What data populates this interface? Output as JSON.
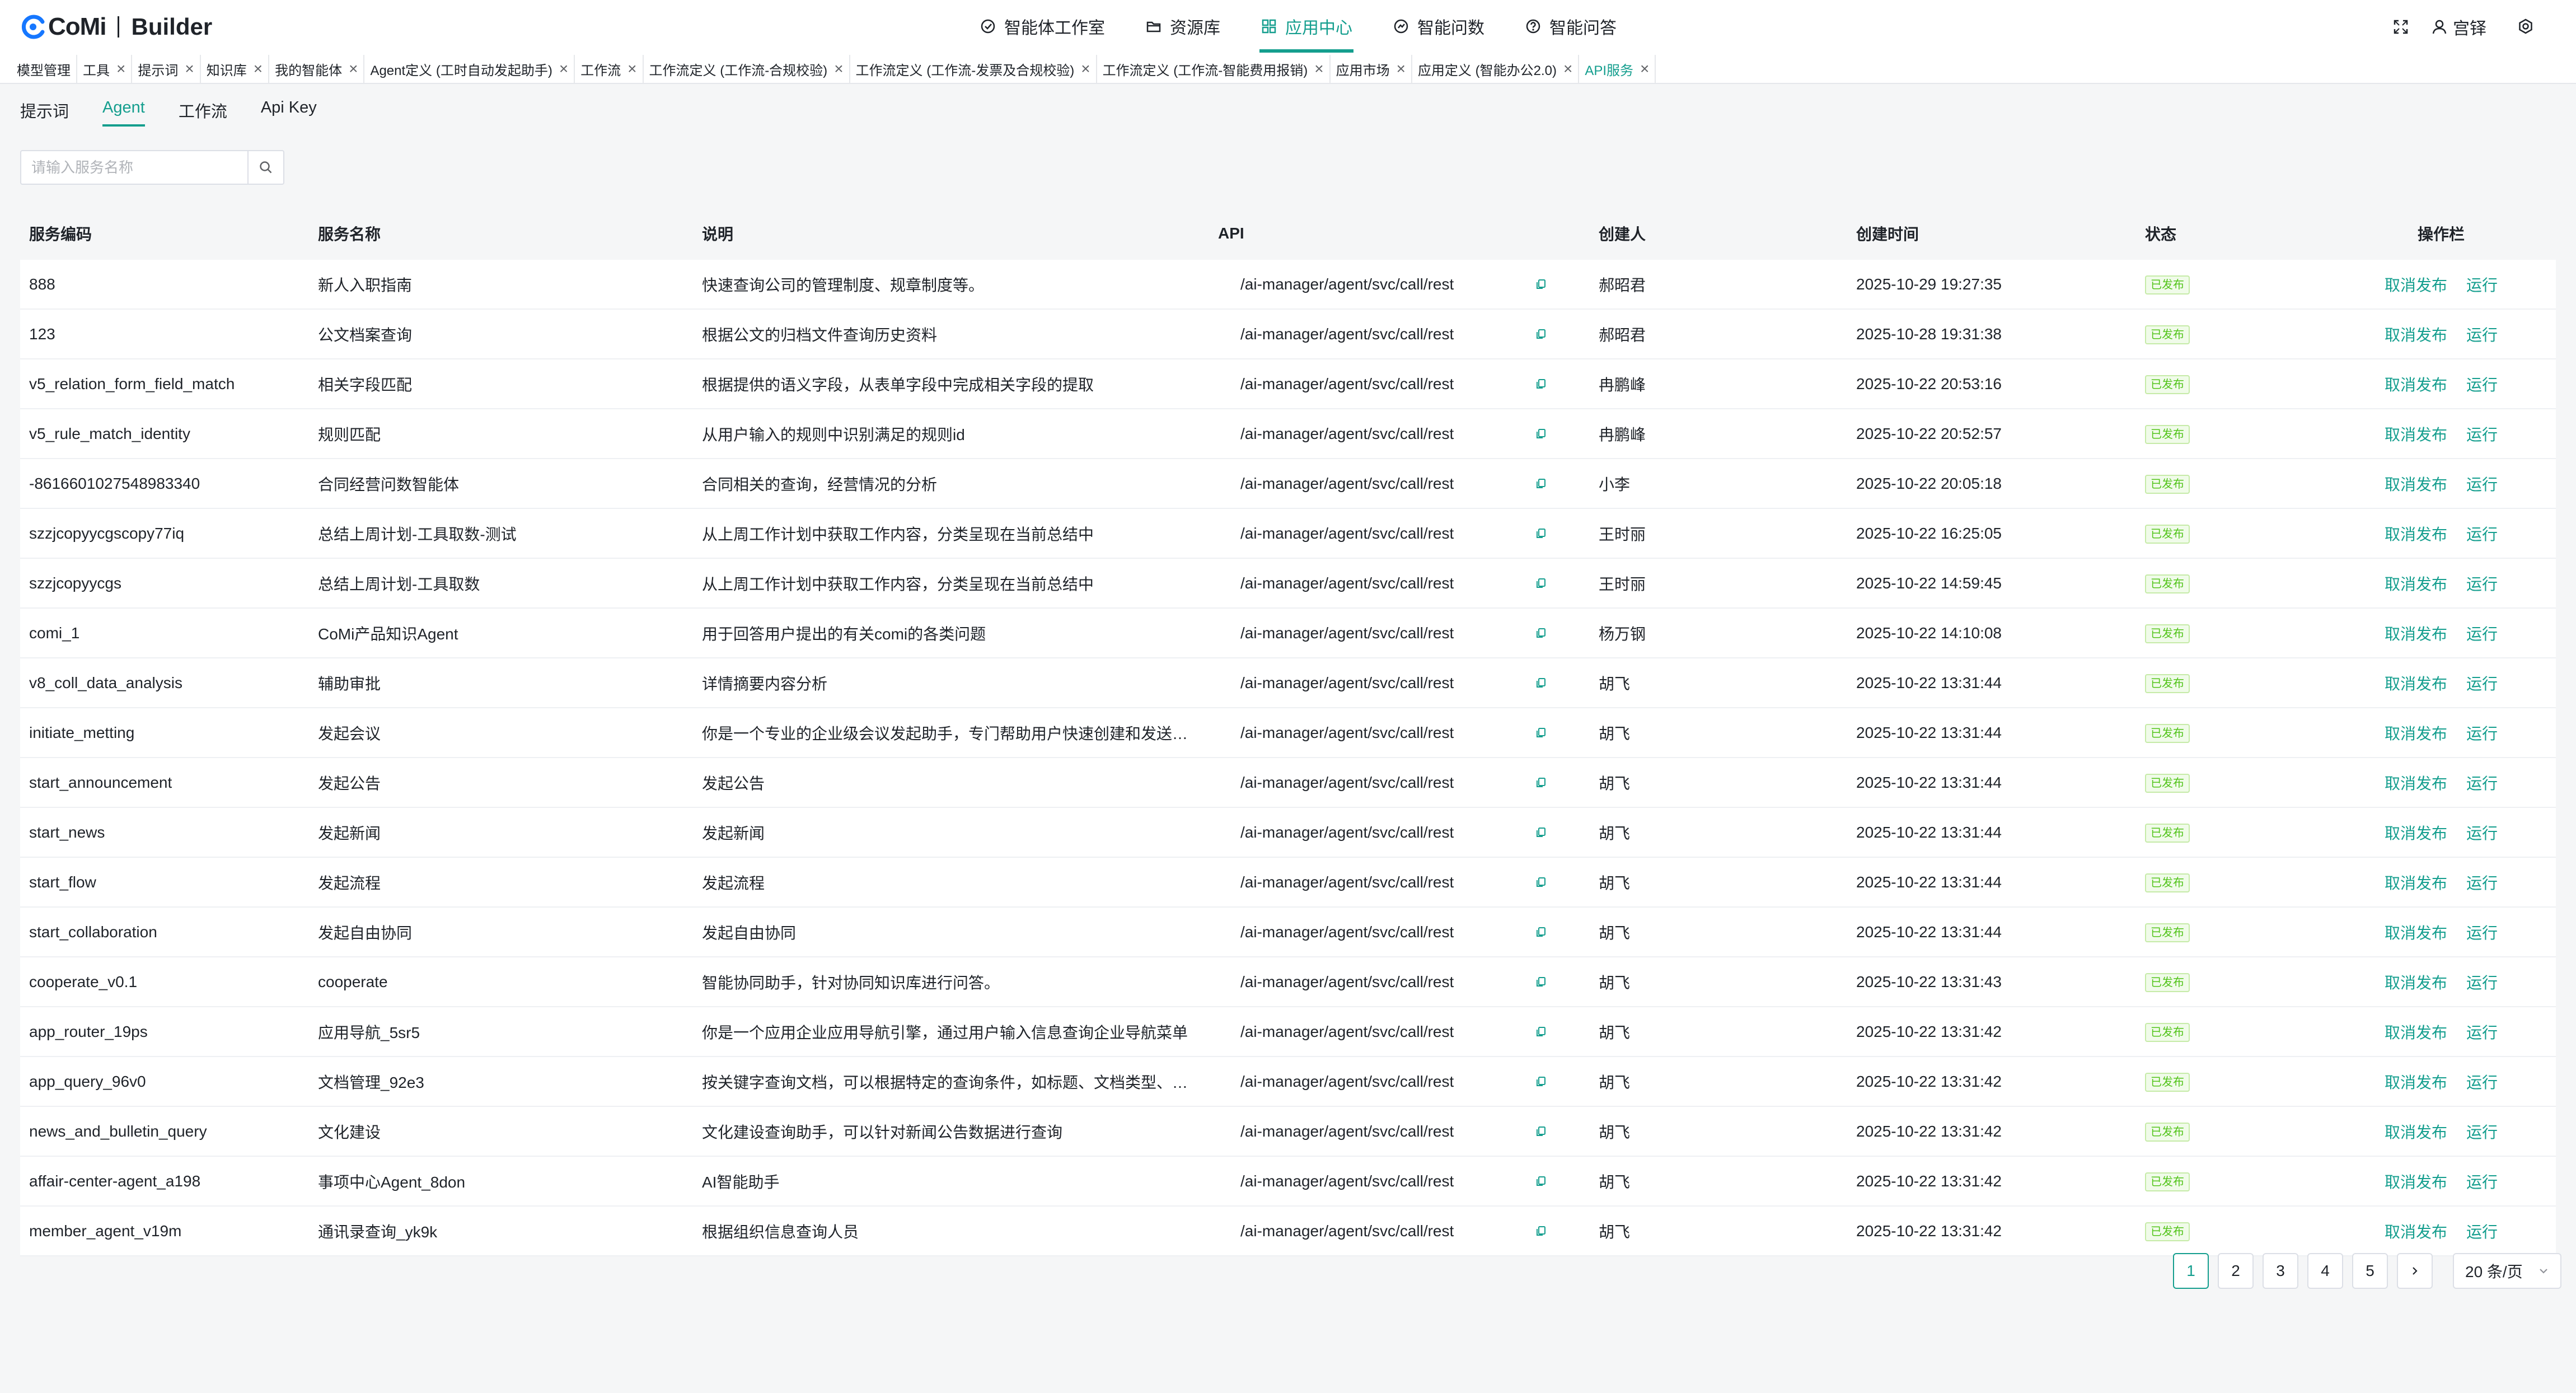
{
  "brand": {
    "logo_text": "CoMi",
    "product": "Builder"
  },
  "nav": {
    "items": [
      {
        "label": "智能体工作室",
        "icon": "agent-studio-icon"
      },
      {
        "label": "资源库",
        "icon": "folder-icon"
      },
      {
        "label": "应用中心",
        "icon": "grid-icon",
        "active": true
      },
      {
        "label": "智能问数",
        "icon": "chart-icon"
      },
      {
        "label": "智能问答",
        "icon": "question-icon"
      }
    ]
  },
  "user": {
    "name": "宫铎"
  },
  "open_tabs": [
    {
      "label": "模型管理",
      "closable": false
    },
    {
      "label": "工具",
      "closable": true
    },
    {
      "label": "提示词",
      "closable": true
    },
    {
      "label": "知识库",
      "closable": true
    },
    {
      "label": "我的智能体",
      "closable": true
    },
    {
      "label": "Agent定义 (工时自动发起助手)",
      "closable": true
    },
    {
      "label": "工作流",
      "closable": true
    },
    {
      "label": "工作流定义 (工作流-合规校验)",
      "closable": true
    },
    {
      "label": "工作流定义 (工作流-发票及合规校验)",
      "closable": true
    },
    {
      "label": "工作流定义 (工作流-智能费用报销)",
      "closable": true
    },
    {
      "label": "应用市场",
      "closable": true
    },
    {
      "label": "应用定义 (智能办公2.0)",
      "closable": true
    },
    {
      "label": "API服务",
      "closable": true,
      "active": true
    }
  ],
  "sub_tabs": [
    {
      "label": "提示词"
    },
    {
      "label": "Agent",
      "active": true
    },
    {
      "label": "工作流"
    },
    {
      "label": "Api Key"
    }
  ],
  "search": {
    "placeholder": "请输入服务名称",
    "value": ""
  },
  "table": {
    "columns": [
      "服务编码",
      "服务名称",
      "说明",
      "API",
      "创建人",
      "创建时间",
      "状态",
      "操作栏"
    ],
    "actions": {
      "unpublish": "取消发布",
      "run": "运行"
    },
    "rows": [
      {
        "code": "888",
        "name": "新人入职指南",
        "desc": "快速查询公司的管理制度、规章制度等。",
        "api": "/ai-manager/agent/svc/call/rest",
        "creator": "郝昭君",
        "created": "2025-10-29 19:27:35",
        "status": "已发布"
      },
      {
        "code": "123",
        "name": "公文档案查询",
        "desc": "根据公文的归档文件查询历史资料",
        "api": "/ai-manager/agent/svc/call/rest",
        "creator": "郝昭君",
        "created": "2025-10-28 19:31:38",
        "status": "已发布"
      },
      {
        "code": "v5_relation_form_field_match",
        "name": "相关字段匹配",
        "desc": "根据提供的语义字段，从表单字段中完成相关字段的提取",
        "api": "/ai-manager/agent/svc/call/rest",
        "creator": "冉鹏峰",
        "created": "2025-10-22 20:53:16",
        "status": "已发布"
      },
      {
        "code": "v5_rule_match_identity",
        "name": "规则匹配",
        "desc": "从用户输入的规则中识别满足的规则id",
        "api": "/ai-manager/agent/svc/call/rest",
        "creator": "冉鹏峰",
        "created": "2025-10-22 20:52:57",
        "status": "已发布"
      },
      {
        "code": "-8616601027548983340",
        "name": "合同经营问数智能体",
        "desc": "合同相关的查询，经营情况的分析",
        "api": "/ai-manager/agent/svc/call/rest",
        "creator": "小李",
        "created": "2025-10-22 20:05:18",
        "status": "已发布"
      },
      {
        "code": "szzjcopyycgscopy77iq",
        "name": "总结上周计划-工具取数-测试",
        "desc": "从上周工作计划中获取工作内容，分类呈现在当前总结中",
        "api": "/ai-manager/agent/svc/call/rest",
        "creator": "王时丽",
        "created": "2025-10-22 16:25:05",
        "status": "已发布"
      },
      {
        "code": "szzjcopyycgs",
        "name": "总结上周计划-工具取数",
        "desc": "从上周工作计划中获取工作内容，分类呈现在当前总结中",
        "api": "/ai-manager/agent/svc/call/rest",
        "creator": "王时丽",
        "created": "2025-10-22 14:59:45",
        "status": "已发布"
      },
      {
        "code": "comi_1",
        "name": "CoMi产品知识Agent",
        "desc": "用于回答用户提出的有关comi的各类问题",
        "api": "/ai-manager/agent/svc/call/rest",
        "creator": "杨万钢",
        "created": "2025-10-22 14:10:08",
        "status": "已发布"
      },
      {
        "code": "v8_coll_data_analysis",
        "name": "辅助审批",
        "desc": "详情摘要内容分析",
        "api": "/ai-manager/agent/svc/call/rest",
        "creator": "胡飞",
        "created": "2025-10-22 13:31:44",
        "status": "已发布"
      },
      {
        "code": "initiate_metting",
        "name": "发起会议",
        "desc": "你是一个专业的企业级会议发起助手，专门帮助用户快速创建和发送会议邀请",
        "api": "/ai-manager/agent/svc/call/rest",
        "creator": "胡飞",
        "created": "2025-10-22 13:31:44",
        "status": "已发布"
      },
      {
        "code": "start_announcement",
        "name": "发起公告",
        "desc": "发起公告",
        "api": "/ai-manager/agent/svc/call/rest",
        "creator": "胡飞",
        "created": "2025-10-22 13:31:44",
        "status": "已发布"
      },
      {
        "code": "start_news",
        "name": "发起新闻",
        "desc": "发起新闻",
        "api": "/ai-manager/agent/svc/call/rest",
        "creator": "胡飞",
        "created": "2025-10-22 13:31:44",
        "status": "已发布"
      },
      {
        "code": "start_flow",
        "name": "发起流程",
        "desc": "发起流程",
        "api": "/ai-manager/agent/svc/call/rest",
        "creator": "胡飞",
        "created": "2025-10-22 13:31:44",
        "status": "已发布"
      },
      {
        "code": "start_collaboration",
        "name": "发起自由协同",
        "desc": "发起自由协同",
        "api": "/ai-manager/agent/svc/call/rest",
        "creator": "胡飞",
        "created": "2025-10-22 13:31:44",
        "status": "已发布"
      },
      {
        "code": "cooperate_v0.1",
        "name": "cooperate",
        "desc": "智能协同助手，针对协同知识库进行问答。",
        "api": "/ai-manager/agent/svc/call/rest",
        "creator": "胡飞",
        "created": "2025-10-22 13:31:43",
        "status": "已发布"
      },
      {
        "code": "app_router_19ps",
        "name": "应用导航_5sr5",
        "desc": "你是一个应用企业应用导航引擎，通过用户输入信息查询企业导航菜单",
        "api": "/ai-manager/agent/svc/call/rest",
        "creator": "胡飞",
        "created": "2025-10-22 13:31:42",
        "status": "已发布"
      },
      {
        "code": "app_query_96v0",
        "name": "文档管理_92e3",
        "desc": "按关键字查询文档，可以根据特定的查询条件，如标题、文档类型、创建时间等",
        "api": "/ai-manager/agent/svc/call/rest",
        "creator": "胡飞",
        "created": "2025-10-22 13:31:42",
        "status": "已发布"
      },
      {
        "code": "news_and_bulletin_query",
        "name": "文化建设",
        "desc": "文化建设查询助手，可以针对新闻公告数据进行查询",
        "api": "/ai-manager/agent/svc/call/rest",
        "creator": "胡飞",
        "created": "2025-10-22 13:31:42",
        "status": "已发布"
      },
      {
        "code": "affair-center-agent_a198",
        "name": "事项中心Agent_8don",
        "desc": "AI智能助手",
        "api": "/ai-manager/agent/svc/call/rest",
        "creator": "胡飞",
        "created": "2025-10-22 13:31:42",
        "status": "已发布"
      },
      {
        "code": "member_agent_v19m",
        "name": "通讯录查询_yk9k",
        "desc": "根据组织信息查询人员",
        "api": "/ai-manager/agent/svc/call/rest",
        "creator": "胡飞",
        "created": "2025-10-22 13:31:42",
        "status": "已发布"
      }
    ]
  },
  "pagination": {
    "pages": [
      "1",
      "2",
      "3",
      "4",
      "5"
    ],
    "current": "1",
    "page_size": "20 条/页"
  },
  "colors": {
    "accent": "#149e8e",
    "status_green": "#52c41a",
    "logo_blue": "#1677ff"
  }
}
